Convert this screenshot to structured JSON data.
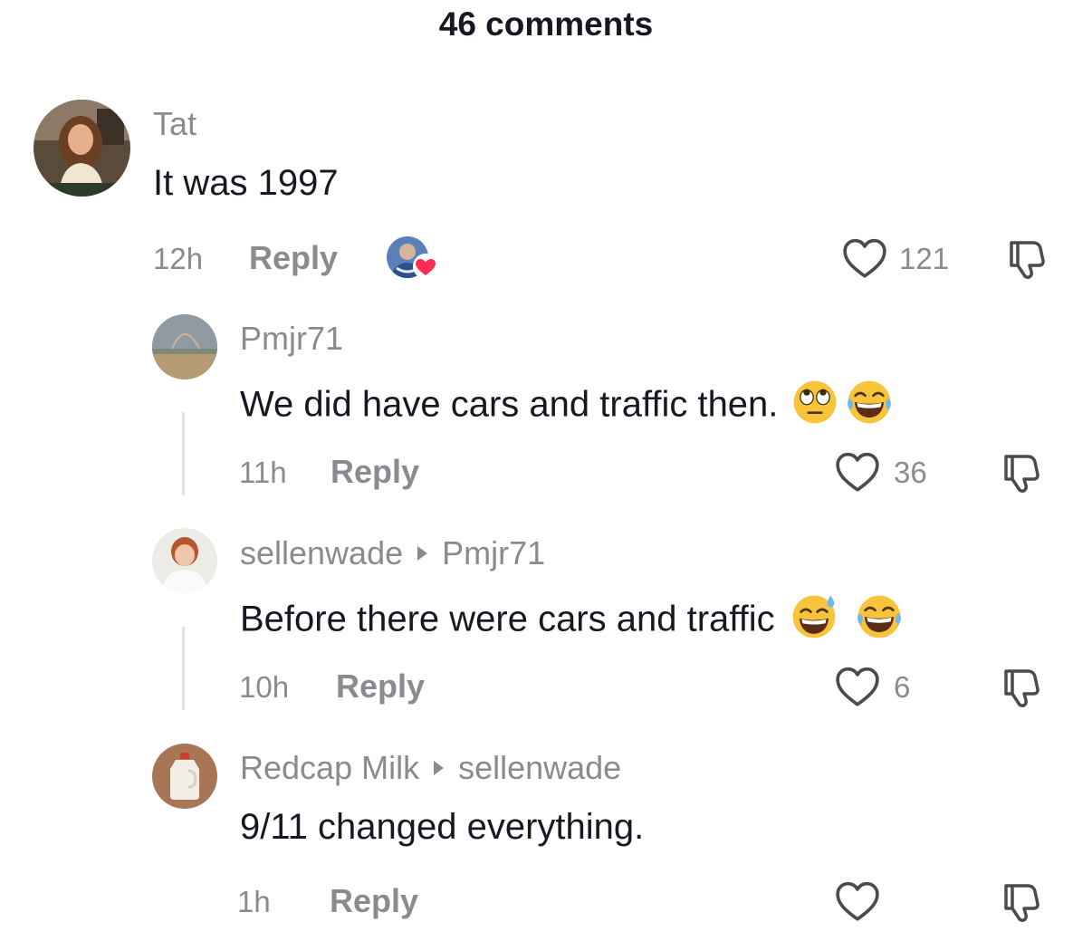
{
  "header": {
    "title": "46 comments"
  },
  "comments": [
    {
      "username": "Tat",
      "reply_to": "",
      "text": "It was 1997",
      "time": "12h",
      "reply_label": "Reply",
      "likes": "121",
      "liked_by_creator": true
    },
    {
      "username": "Pmjr71",
      "reply_to": "",
      "text": "We did have cars and traffic then.",
      "emojis": [
        "face-with-rolling-eyes",
        "face-with-tears-of-joy"
      ],
      "time": "11h",
      "reply_label": "Reply",
      "likes": "36"
    },
    {
      "username": "sellenwade",
      "reply_to": "Pmjr71",
      "text": "Before there were cars and traffic",
      "emojis": [
        "grinning-face-with-sweat",
        "face-with-tears-of-joy"
      ],
      "time": "10h",
      "reply_label": "Reply",
      "likes": "6"
    },
    {
      "username": "Redcap Milk",
      "reply_to": "sellenwade",
      "text": "9/11 changed everything.",
      "time": "1h",
      "reply_label": "Reply",
      "likes": ""
    }
  ],
  "icons": {
    "like": "heart-outline-icon",
    "dislike": "thumbs-down-icon",
    "creator_like": "creator-avatar-heart-badge"
  },
  "colors": {
    "primary_text": "#161823",
    "secondary_text": "#8a8b91",
    "heart_badge": "#fe2c55"
  }
}
